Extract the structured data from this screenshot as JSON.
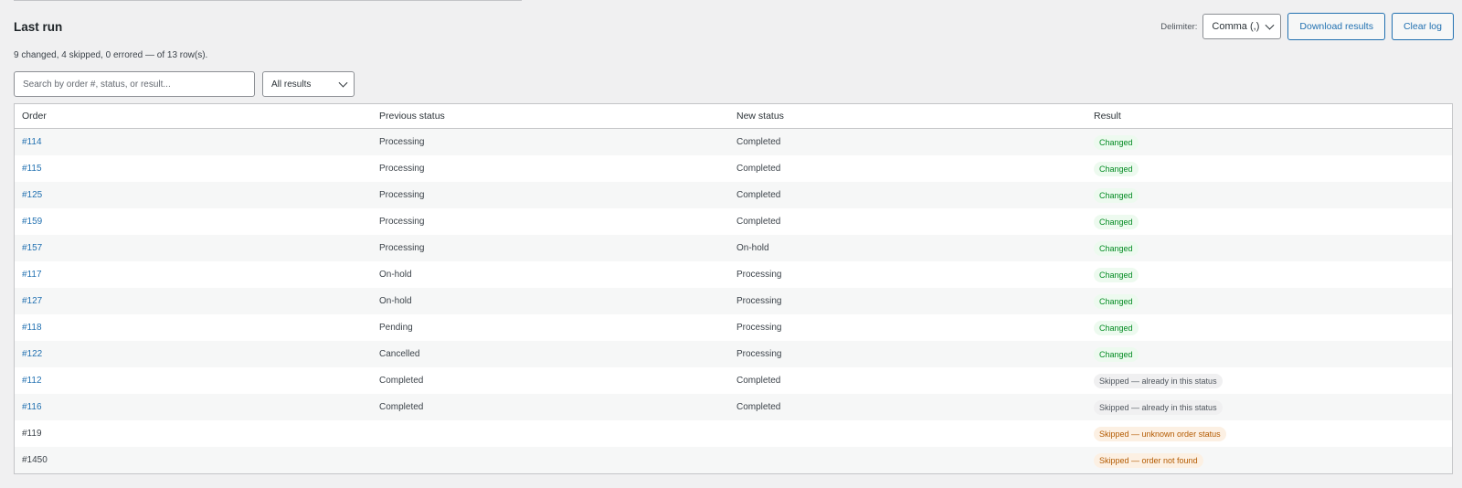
{
  "header": {
    "title": "Last run",
    "delimiter_label": "Delimiter:",
    "delimiter_value": "Comma (,)",
    "download_label": "Download results",
    "clear_label": "Clear log"
  },
  "summary": "9 changed, 4 skipped, 0 errored — of 13 row(s).",
  "filters": {
    "search_placeholder": "Search by order #, status, or result...",
    "result_filter": "All results"
  },
  "table": {
    "columns": [
      "Order",
      "Previous status",
      "New status",
      "Result"
    ],
    "rows": [
      {
        "order": "#114",
        "link": true,
        "previous": "Processing",
        "new": "Completed",
        "result": "Changed",
        "kind": "changed"
      },
      {
        "order": "#115",
        "link": true,
        "previous": "Processing",
        "new": "Completed",
        "result": "Changed",
        "kind": "changed"
      },
      {
        "order": "#125",
        "link": true,
        "previous": "Processing",
        "new": "Completed",
        "result": "Changed",
        "kind": "changed"
      },
      {
        "order": "#159",
        "link": true,
        "previous": "Processing",
        "new": "Completed",
        "result": "Changed",
        "kind": "changed"
      },
      {
        "order": "#157",
        "link": true,
        "previous": "Processing",
        "new": "On-hold",
        "result": "Changed",
        "kind": "changed"
      },
      {
        "order": "#117",
        "link": true,
        "previous": "On-hold",
        "new": "Processing",
        "result": "Changed",
        "kind": "changed"
      },
      {
        "order": "#127",
        "link": true,
        "previous": "On-hold",
        "new": "Processing",
        "result": "Changed",
        "kind": "changed"
      },
      {
        "order": "#118",
        "link": true,
        "previous": "Pending",
        "new": "Processing",
        "result": "Changed",
        "kind": "changed"
      },
      {
        "order": "#122",
        "link": true,
        "previous": "Cancelled",
        "new": "Processing",
        "result": "Changed",
        "kind": "changed"
      },
      {
        "order": "#112",
        "link": true,
        "previous": "Completed",
        "new": "Completed",
        "result": "Skipped — already in this status",
        "kind": "skipped"
      },
      {
        "order": "#116",
        "link": true,
        "previous": "Completed",
        "new": "Completed",
        "result": "Skipped — already in this status",
        "kind": "skipped"
      },
      {
        "order": "#119",
        "link": false,
        "previous": "",
        "new": "",
        "result": "Skipped — unknown order status",
        "kind": "warning"
      },
      {
        "order": "#1450",
        "link": false,
        "previous": "",
        "new": "",
        "result": "Skipped — order not found",
        "kind": "warning"
      }
    ]
  },
  "colors": {
    "link": "#2271b1",
    "changed_bg": "#edfaef",
    "changed_text": "#008a20",
    "skipped_bg": "#f0f0f1",
    "warning_bg": "#fcf0e3",
    "warning_text": "#b35a00"
  },
  "icons": {
    "select_arrow": "chevron-down-icon"
  }
}
